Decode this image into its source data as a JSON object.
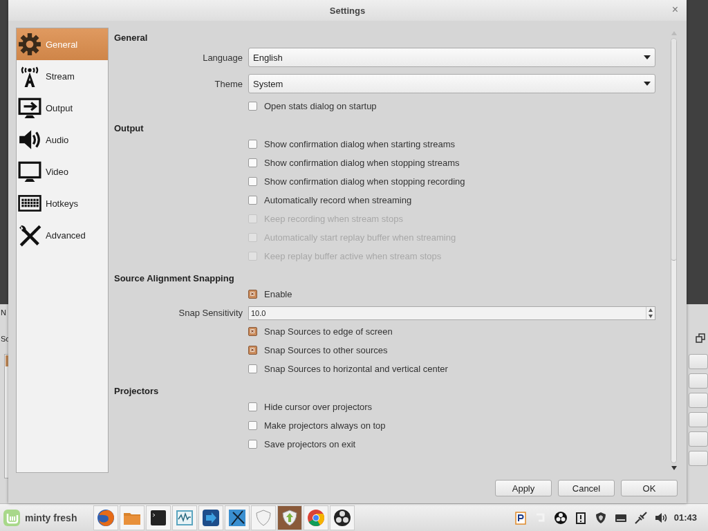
{
  "background_window": {
    "labels": [
      "N",
      "So"
    ]
  },
  "window": {
    "title": "Settings",
    "close": "×"
  },
  "sidebar": {
    "items": [
      {
        "label": "General",
        "selected": true
      },
      {
        "label": "Stream",
        "selected": false
      },
      {
        "label": "Output",
        "selected": false
      },
      {
        "label": "Audio",
        "selected": false
      },
      {
        "label": "Video",
        "selected": false
      },
      {
        "label": "Hotkeys",
        "selected": false
      },
      {
        "label": "Advanced",
        "selected": false
      }
    ]
  },
  "sections": [
    {
      "title": "General",
      "rows": [
        {
          "kind": "dropdown",
          "label": "Language",
          "value": "English"
        },
        {
          "kind": "dropdown",
          "label": "Theme",
          "value": "System"
        },
        {
          "kind": "checkbox",
          "label": "Open stats dialog on startup",
          "checked": false,
          "disabled": false
        }
      ]
    },
    {
      "title": "Output",
      "rows": [
        {
          "kind": "checkbox",
          "label": "Show confirmation dialog when starting streams",
          "checked": false,
          "disabled": false
        },
        {
          "kind": "checkbox",
          "label": "Show confirmation dialog when stopping streams",
          "checked": false,
          "disabled": false
        },
        {
          "kind": "checkbox",
          "label": "Show confirmation dialog when stopping recording",
          "checked": false,
          "disabled": false
        },
        {
          "kind": "checkbox",
          "label": "Automatically record when streaming",
          "checked": false,
          "disabled": false
        },
        {
          "kind": "checkbox",
          "label": "Keep recording when stream stops",
          "checked": false,
          "disabled": true
        },
        {
          "kind": "checkbox",
          "label": "Automatically start replay buffer when streaming",
          "checked": false,
          "disabled": true
        },
        {
          "kind": "checkbox",
          "label": "Keep replay buffer active when stream stops",
          "checked": false,
          "disabled": true
        }
      ]
    },
    {
      "title": "Source Alignment Snapping",
      "rows": [
        {
          "kind": "checkbox",
          "label": "Enable",
          "checked": true,
          "disabled": false
        },
        {
          "kind": "spinbox",
          "label": "Snap Sensitivity",
          "value": "10.0"
        },
        {
          "kind": "checkbox",
          "label": "Snap Sources to edge of screen",
          "checked": true,
          "disabled": false
        },
        {
          "kind": "checkbox",
          "label": "Snap Sources to other sources",
          "checked": true,
          "disabled": false
        },
        {
          "kind": "checkbox",
          "label": "Snap Sources to horizontal and vertical center",
          "checked": false,
          "disabled": false
        }
      ]
    },
    {
      "title": "Projectors",
      "rows": [
        {
          "kind": "checkbox",
          "label": "Hide cursor over projectors",
          "checked": false,
          "disabled": false
        },
        {
          "kind": "checkbox",
          "label": "Make projectors always on top",
          "checked": false,
          "disabled": false
        },
        {
          "kind": "checkbox",
          "label": "Save projectors on exit",
          "checked": false,
          "disabled": false
        }
      ]
    }
  ],
  "buttons": [
    "Apply",
    "Cancel",
    "OK"
  ],
  "taskbar": {
    "start": "minty fresh",
    "launchers": [
      {
        "selected": false
      },
      {
        "selected": false
      },
      {
        "selected": false
      },
      {
        "selected": false
      },
      {
        "selected": false
      },
      {
        "selected": false
      },
      {
        "selected": false
      },
      {
        "selected": true
      },
      {
        "selected": false
      },
      {
        "selected": false
      }
    ],
    "clock": "01:43"
  }
}
